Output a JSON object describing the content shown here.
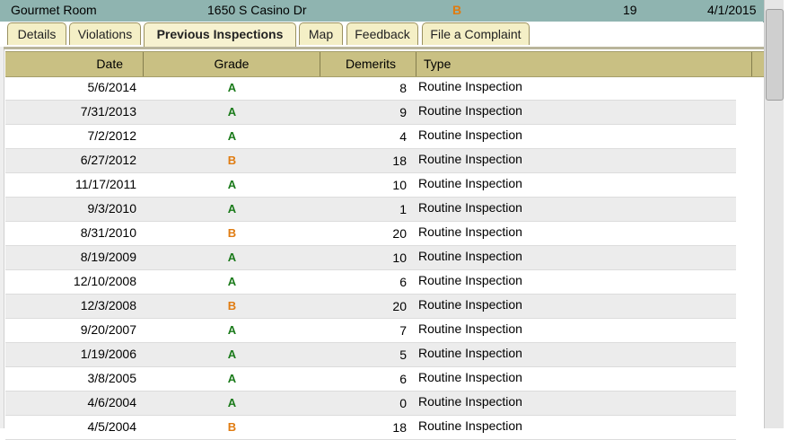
{
  "summary": {
    "name": "Gourmet Room",
    "address": "1650 S Casino Dr",
    "grade": "B",
    "demerits": "19",
    "date": "4/1/2015"
  },
  "tabs": [
    {
      "label": "Details"
    },
    {
      "label": "Violations"
    },
    {
      "label": "Previous Inspections",
      "active": true
    },
    {
      "label": "Map"
    },
    {
      "label": "Feedback"
    },
    {
      "label": "File a Complaint"
    }
  ],
  "table": {
    "headers": {
      "date": "Date",
      "grade": "Grade",
      "demerits": "Demerits",
      "type": "Type"
    },
    "rows": [
      {
        "date": "5/6/2014",
        "grade": "A",
        "demerits": "8",
        "type": "Routine Inspection"
      },
      {
        "date": "7/31/2013",
        "grade": "A",
        "demerits": "9",
        "type": "Routine Inspection"
      },
      {
        "date": "7/2/2012",
        "grade": "A",
        "demerits": "4",
        "type": "Routine Inspection"
      },
      {
        "date": "6/27/2012",
        "grade": "B",
        "demerits": "18",
        "type": "Routine Inspection"
      },
      {
        "date": "11/17/2011",
        "grade": "A",
        "demerits": "10",
        "type": "Routine Inspection"
      },
      {
        "date": "9/3/2010",
        "grade": "A",
        "demerits": "1",
        "type": "Routine Inspection"
      },
      {
        "date": "8/31/2010",
        "grade": "B",
        "demerits": "20",
        "type": "Routine Inspection"
      },
      {
        "date": "8/19/2009",
        "grade": "A",
        "demerits": "10",
        "type": "Routine Inspection"
      },
      {
        "date": "12/10/2008",
        "grade": "A",
        "demerits": "6",
        "type": "Routine Inspection"
      },
      {
        "date": "12/3/2008",
        "grade": "B",
        "demerits": "20",
        "type": "Routine Inspection"
      },
      {
        "date": "9/20/2007",
        "grade": "A",
        "demerits": "7",
        "type": "Routine Inspection"
      },
      {
        "date": "1/19/2006",
        "grade": "A",
        "demerits": "5",
        "type": "Routine Inspection"
      },
      {
        "date": "3/8/2005",
        "grade": "A",
        "demerits": "6",
        "type": "Routine Inspection"
      },
      {
        "date": "4/6/2004",
        "grade": "A",
        "demerits": "0",
        "type": "Routine Inspection"
      },
      {
        "date": "4/5/2004",
        "grade": "B",
        "demerits": "18",
        "type": "Routine Inspection"
      }
    ]
  },
  "colors": {
    "grade_A": "#1a7a1a",
    "grade_B": "#e07b10",
    "summary_bar": "#8fb4b0",
    "header_bar": "#c9c083",
    "tab_bg": "#f4efc6"
  }
}
